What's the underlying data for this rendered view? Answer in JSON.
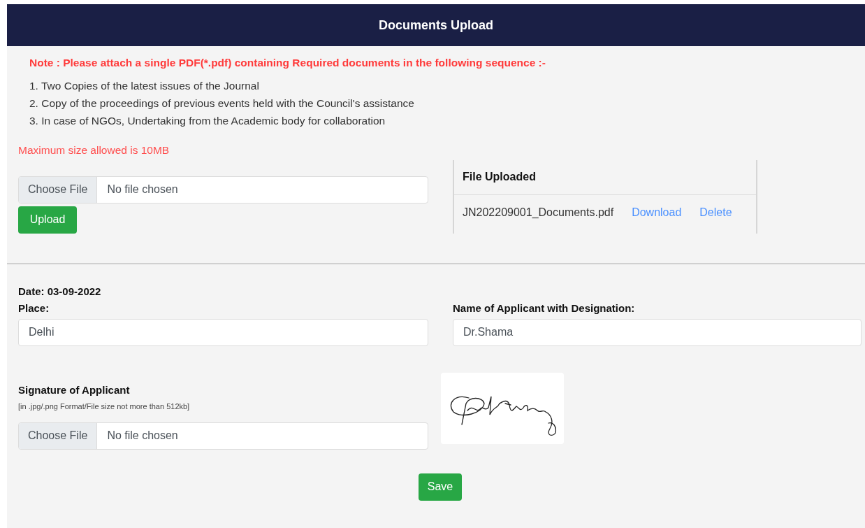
{
  "header": {
    "title": "Documents Upload"
  },
  "note": "Note : Please attach a single PDF(*.pdf) containing Required documents in the following sequence :-",
  "requirements": [
    "1. Two Copies of the latest issues of the Journal",
    "2. Copy of the proceedings of previous events held with the Council's assistance",
    "3. In case of NGOs, Undertaking from the Academic body for collaboration"
  ],
  "max_size_note": "Maximum size allowed is 10MB",
  "document_file": {
    "button": "Choose File",
    "status": "No file chosen"
  },
  "upload_button": "Upload",
  "uploaded_table": {
    "heading": "File Uploaded",
    "rows": [
      {
        "file_name": "JN202209001_Documents.pdf",
        "download": "Download",
        "delete": "Delete"
      }
    ]
  },
  "date": "Date: 03-09-2022",
  "place": {
    "label": "Place:",
    "value": "Delhi"
  },
  "applicant": {
    "label": "Name of Applicant with Designation:",
    "value": "Dr.Shama"
  },
  "signature": {
    "label": "Signature of Applicant",
    "hint": "[in .jpg/.png Format/File size not more than 512kb]",
    "button": "Choose File",
    "status": "No file chosen"
  },
  "save_button": "Save"
}
